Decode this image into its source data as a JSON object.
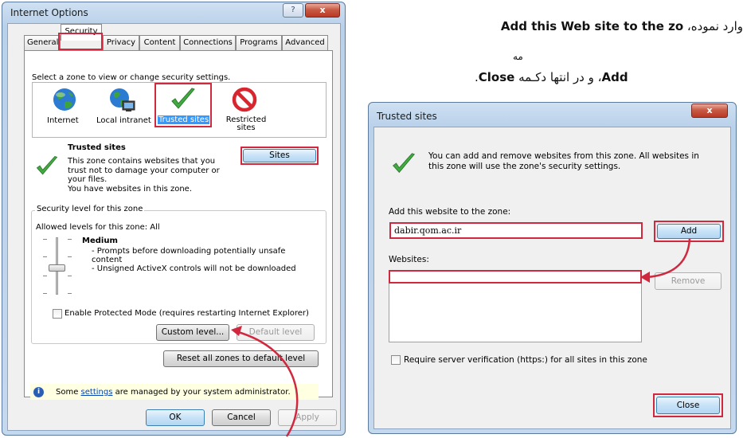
{
  "internet_options": {
    "title": "Internet Options",
    "help_btn": "?",
    "close_btn": "x",
    "tabs": [
      "General",
      "Security",
      "Privacy",
      "Content",
      "Connections",
      "Programs",
      "Advanced"
    ],
    "zone_prompt": "Select a zone to view or change security settings.",
    "zones": [
      "Internet",
      "Local intranet",
      "Trusted sites",
      "Restricted sites"
    ],
    "zone_title": "Trusted sites",
    "zone_desc": [
      "This zone contains websites that you",
      "trust not to damage your computer or",
      "your files.",
      "You have websites in this zone."
    ],
    "sites_btn": "Sites",
    "security_level_label": "Security level for this zone",
    "allowed_levels": "Allowed levels for this zone: All",
    "level_name": "Medium",
    "level_bullets": [
      "- Prompts before downloading potentially unsafe",
      "content",
      "- Unsigned ActiveX controls will not be downloaded"
    ],
    "protected_mode": "Enable Protected Mode (requires restarting Internet Explorer)",
    "custom_level_btn": "Custom level...",
    "default_level_btn": "Default level",
    "reset_btn": "Reset all zones to default level",
    "info_prefix": "Some",
    "info_link": "settings",
    "info_suffix": "are managed by your system administrator.",
    "ok_btn": "OK",
    "cancel_btn": "Cancel",
    "apply_btn": "Apply"
  },
  "trusted_sites": {
    "title": "Trusted sites",
    "close_btn": "x",
    "description": [
      "You can add and remove websites from this zone. All websites in",
      "this zone will use the zone's security settings."
    ],
    "add_label": "Add this website to the zone:",
    "add_value": "dabir.qom.ac.ir",
    "add_btn": "Add",
    "websites_label": "Websites:",
    "remove_btn": "Remove",
    "require_https": "Require server verification (https:) for all sites in this zone",
    "close_btn_label": "Close"
  },
  "instructions": {
    "line1_bold": "Add this Web site to the zo",
    "line1_rest": "وارد نموده،",
    "line2_tail": "مه",
    "line3_bold": "Add",
    "line3_rest": "، و در انتها دکـمه",
    "line3_bold2": "Close",
    "line3_end": "."
  },
  "colors": {
    "highlight": "#d0283e",
    "link": "#0645ad",
    "info_bg": "#ffffe1"
  }
}
